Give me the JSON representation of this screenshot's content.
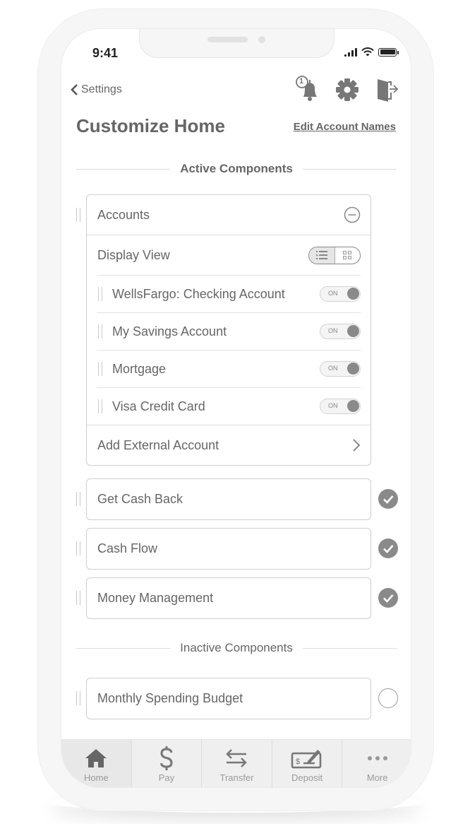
{
  "status_bar": {
    "time": "9:41"
  },
  "header": {
    "back_label": "Settings",
    "notification_count": "1",
    "title": "Customize Home",
    "edit_link": "Edit Account Names"
  },
  "active_section": {
    "label": "Active Components",
    "accounts_card": {
      "title": "Accounts",
      "display_view_label": "Display View",
      "display_view_selected": "list",
      "accounts": [
        {
          "name": "WellsFargo: Checking Account",
          "toggle": "ON"
        },
        {
          "name": "My Savings Account",
          "toggle": "ON"
        },
        {
          "name": "Mortgage",
          "toggle": "ON"
        },
        {
          "name": "Visa Credit Card",
          "toggle": "ON"
        }
      ],
      "add_external": "Add External Account"
    },
    "components": [
      {
        "name": "Get Cash Back",
        "checked": true
      },
      {
        "name": "Cash Flow",
        "checked": true
      },
      {
        "name": "Money Management",
        "checked": true
      }
    ]
  },
  "inactive_section": {
    "label": "Inactive Components",
    "components": [
      {
        "name": "Monthly Spending Budget",
        "checked": false
      }
    ]
  },
  "tab_bar": {
    "active": "Home",
    "tabs": [
      {
        "label": "Home",
        "icon": "home-icon"
      },
      {
        "label": "Pay",
        "icon": "dollar-icon"
      },
      {
        "label": "Transfer",
        "icon": "transfer-arrows-icon"
      },
      {
        "label": "Deposit",
        "icon": "check-deposit-icon"
      },
      {
        "label": "More",
        "icon": "more-dots-icon"
      }
    ]
  },
  "colors": {
    "icon_gray": "#777777",
    "text_gray": "#666666",
    "check_fill": "#8a8a8a"
  }
}
